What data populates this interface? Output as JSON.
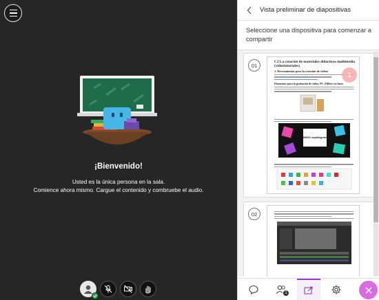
{
  "stage": {
    "welcome": "¡Bienvenido!",
    "message_line1": "Usted es la única persona en la sala.",
    "message_line2": "Comience ahora mismo. Cargue el contenido y combruebe el audio."
  },
  "panel": {
    "title": "Vista preliminar de diapositivas",
    "description": "Seleccione una dispositiva para comenzar a compartir",
    "slides": [
      {
        "number": "01",
        "badge": "1",
        "doc_title": "C2 La creación de materiales didácticos multimedia (videotutoriales)",
        "doc_sub": "1. Herramientas para la creación de vídeos",
        "doc_head1": "Elementos para la grabación de vídeo, PC (Office) en línea",
        "doc_logo": "MIDIO capitalgrant"
      },
      {
        "number": "02"
      }
    ]
  },
  "bottom": {
    "participants_count": "1"
  },
  "colors": {
    "stage_bg": "#262626",
    "accent": "#9a3fc0",
    "close_button": "#d96be0",
    "status_ok": "#2fa84f"
  }
}
